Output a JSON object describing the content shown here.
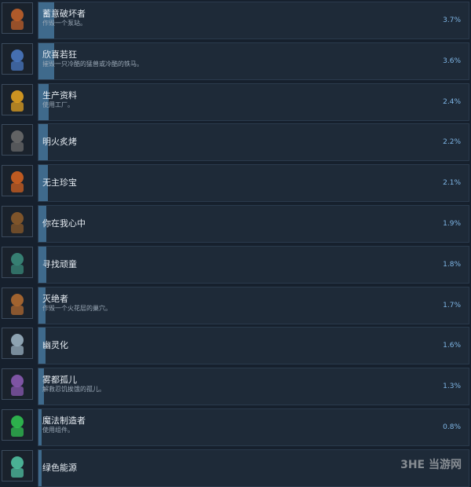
{
  "achievements": [
    {
      "title": "蓄意破坏者",
      "desc": "作毁一个泵站。",
      "pct": "3.7%",
      "value": 3.7,
      "icon": "saboteur-icon",
      "color": "#c0602a"
    },
    {
      "title": "欣喜若狂",
      "desc": "摧毁一只冷酷的猛兽或冷酷的铁马。",
      "pct": "3.6%",
      "value": 3.6,
      "icon": "guillotine-icon",
      "color": "#4a78c0"
    },
    {
      "title": "生产资料",
      "desc": "使用工厂。",
      "pct": "2.4%",
      "value": 2.4,
      "icon": "gear-icon",
      "color": "#e0a020"
    },
    {
      "title": "明火炙烤",
      "desc": "",
      "pct": "2.2%",
      "value": 2.2,
      "icon": "furnace-icon",
      "color": "#6a6a6a"
    },
    {
      "title": "无主珍宝",
      "desc": "",
      "pct": "2.1%",
      "value": 2.1,
      "icon": "treasure-icon",
      "color": "#d06020"
    },
    {
      "title": "你在我心中",
      "desc": "",
      "pct": "1.9%",
      "value": 1.9,
      "icon": "robot-icon",
      "color": "#8a5a2a"
    },
    {
      "title": "寻找顽童",
      "desc": "",
      "pct": "1.8%",
      "value": 1.8,
      "icon": "hooded-child-icon",
      "color": "#3a8a7a"
    },
    {
      "title": "灭绝者",
      "desc": "作毁一个火花层的巢穴。",
      "pct": "1.7%",
      "value": 1.7,
      "icon": "nest-icon",
      "color": "#b06a30"
    },
    {
      "title": "幽灵化",
      "desc": "",
      "pct": "1.6%",
      "value": 1.6,
      "icon": "ghost-icon",
      "color": "#9ab0c0"
    },
    {
      "title": "雾都孤儿",
      "desc": "解救忍饥挨饿的孤儿。",
      "pct": "1.3%",
      "value": 1.3,
      "icon": "orphan-icon",
      "color": "#8a5ab0"
    },
    {
      "title": "魔法制造者",
      "desc": "使用组件。",
      "pct": "0.8%",
      "value": 0.8,
      "icon": "crystal-icon",
      "color": "#30c050"
    },
    {
      "title": "绿色能源",
      "desc": "",
      "pct": "",
      "value": 0.6,
      "icon": "lantern-icon",
      "color": "#50c0a0"
    }
  ],
  "watermark": "3HE 当游网"
}
